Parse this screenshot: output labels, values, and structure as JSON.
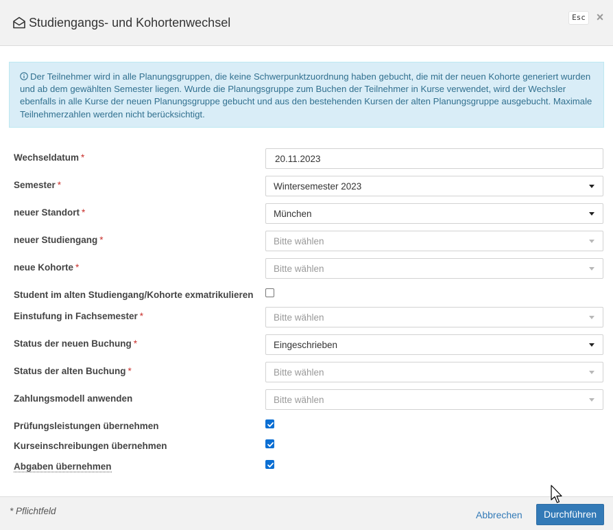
{
  "dialog": {
    "title": "Studiengangs- und Kohortenwechsel",
    "esc_label": "Esc",
    "close_label": "×"
  },
  "info": {
    "text": "Der Teilnehmer wird in alle Planungsgruppen, die keine Schwerpunktzuordnung haben gebucht, die mit der neuen Kohorte generiert wurden und ab dem gewählten Semester liegen. Wurde die Planungsgruppe zum Buchen der Teilnehmer in Kurse verwendet, wird der Wechsler ebenfalls in alle Kurse der neuen Planungsgruppe gebucht und aus den bestehenden Kursen der alten Planungsgruppe ausgebucht. Maximale Teilnehmerzahlen werden nicht berücksichtigt."
  },
  "form": {
    "required_mark": "*",
    "fields": [
      {
        "label": "Wechseldatum",
        "value": "20.11.2023"
      },
      {
        "label": "Semester",
        "value": "Wintersemester 2023"
      },
      {
        "label": "neuer Standort",
        "value": "München"
      },
      {
        "label": "neuer Studiengang",
        "placeholder": "Bitte wählen"
      },
      {
        "label": "neue Kohorte",
        "placeholder": "Bitte wählen"
      },
      {
        "label": "Student im alten Studiengang/Kohorte exmatrikulieren",
        "checked": false
      },
      {
        "label": "Einstufung in Fachsemester",
        "placeholder": "Bitte wählen"
      },
      {
        "label": "Status der neuen Buchung",
        "value": "Eingeschrieben"
      },
      {
        "label": "Status der alten Buchung",
        "placeholder": "Bitte wählen"
      },
      {
        "label": "Zahlungsmodell anwenden",
        "placeholder": "Bitte wählen"
      },
      {
        "label": "Prüfungsleistungen übernehmen",
        "checked": true
      },
      {
        "label": "Kurseinschreibungen übernehmen",
        "checked": true
      },
      {
        "label": "Abgaben übernehmen",
        "checked": true
      }
    ]
  },
  "footer": {
    "required_hint": "* Pflichtfeld",
    "cancel_label": "Abbrechen",
    "submit_label": "Durchführen"
  },
  "colors": {
    "primary": "#337ab7",
    "info_bg": "#d9edf7",
    "info_text": "#31708f",
    "required": "#c9302c",
    "checkbox": "#0b6fd3"
  }
}
